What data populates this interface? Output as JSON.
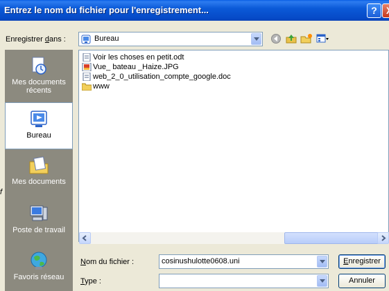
{
  "dialog": {
    "title": "Entrez le nom du fichier pour l'enregistrement...",
    "help_glyph": "?",
    "close_glyph": "X"
  },
  "save_in": {
    "label_pre": "Enregistrer ",
    "label_u": "d",
    "label_post": "ans :",
    "value": "Bureau"
  },
  "places": [
    {
      "label_1": "Mes documents",
      "label_2": "récents"
    },
    {
      "label_1": "Bureau"
    },
    {
      "label_1": "Mes documents"
    },
    {
      "label_1": "Poste de travail"
    },
    {
      "label_1": "Favoris réseau"
    }
  ],
  "files": [
    {
      "name": "Voir les choses en petit.odt",
      "icon": "document-icon"
    },
    {
      "name": "Vue_ bateau _Haize.JPG",
      "icon": "image-icon"
    },
    {
      "name": "web_2_0_utilisation_compte_google.doc",
      "icon": "document-icon"
    },
    {
      "name": "www",
      "icon": "folder-icon"
    }
  ],
  "filename": {
    "label_u": "N",
    "label_rest": "om du fichier :",
    "value": "cosinushulotte0608.uni"
  },
  "filetype": {
    "label_u": "T",
    "label_rest": "ype :",
    "value": ""
  },
  "buttons": {
    "save_u": "E",
    "save_rest": "nregistrer",
    "cancel": "Annuler"
  },
  "stray_char": "f",
  "colors": {
    "titlebar": "#0b5ad8",
    "dialog_bg": "#ece9d8",
    "places_bg": "#8c8a7f",
    "close_btn": "#c8391c"
  }
}
